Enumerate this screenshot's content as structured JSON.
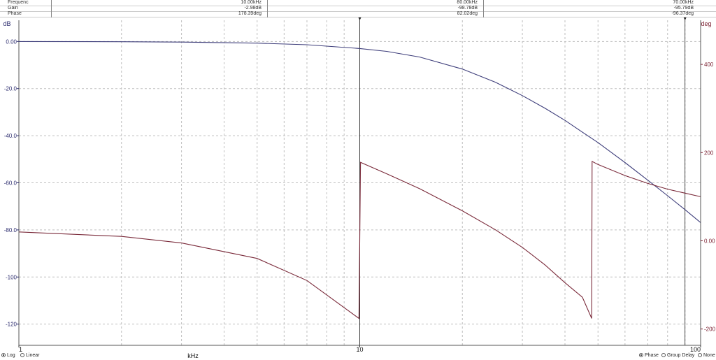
{
  "readout": {
    "labels": [
      "Frequenc",
      "Gain",
      "Phase"
    ],
    "cursor1": [
      "10.00kHz",
      "-2.98dB",
      "178.39deg"
    ],
    "cursor2": [
      "80.00kHz",
      "-98.78dB",
      "82.02deg"
    ],
    "cursor3": [
      "70.00kHz",
      "-95.79dB",
      "-96.37deg"
    ]
  },
  "footer": {
    "x_mode_options": [
      {
        "label": "Log",
        "selected": true
      },
      {
        "label": "Linear",
        "selected": false
      }
    ],
    "y2_mode_options": [
      {
        "label": "Phase",
        "selected": true
      },
      {
        "label": "Group Delay",
        "selected": false
      },
      {
        "label": "None",
        "selected": false
      }
    ]
  },
  "colors": {
    "gain": "#3d3d7a",
    "phase": "#7a2a3a",
    "grid": "#bfbfbf",
    "axis_left": "#2c2c6e",
    "axis_right": "#7a1f30",
    "cursor": "#222222"
  },
  "chart_data": {
    "type": "line",
    "x_scale": "log",
    "xlabel": "kHz",
    "x_tick_labels": [
      "1",
      "10",
      "100"
    ],
    "xlim": [
      1,
      100
    ],
    "y_left_unit": "dB",
    "y_left_ticks": [
      "0.00",
      "-20.0",
      "-40.0",
      "-60.0",
      "-80.0",
      "-100",
      "-120"
    ],
    "y_left_lim": [
      -129,
      9
    ],
    "y_right_unit": "deg",
    "y_right_ticks": [
      "400",
      "200",
      "0.00",
      "-200"
    ],
    "y_right_lim": [
      -237,
      500
    ],
    "grid": true,
    "cursors_khz": [
      10,
      90
    ],
    "series": [
      {
        "axis": "left",
        "points": [
          [
            1,
            -0.03
          ],
          [
            2,
            -0.1
          ],
          [
            3,
            -0.25
          ],
          [
            5,
            -0.7
          ],
          [
            7,
            -1.4
          ],
          [
            10,
            -2.98
          ],
          [
            12,
            -4.2
          ],
          [
            15,
            -6.6
          ],
          [
            20,
            -11.7
          ],
          [
            25,
            -17.3
          ],
          [
            30,
            -23.0
          ],
          [
            35,
            -28.4
          ],
          [
            40,
            -33.5
          ],
          [
            45,
            -38.5
          ],
          [
            50,
            -42.9
          ],
          [
            60,
            -51.4
          ],
          [
            70,
            -58.9
          ],
          [
            80,
            -65.5
          ],
          [
            90,
            -71.4
          ],
          [
            100,
            -76.9
          ]
        ]
      },
      {
        "axis": "right",
        "points": [
          [
            1,
            20
          ],
          [
            2,
            10
          ],
          [
            3,
            -5
          ],
          [
            5,
            -40
          ],
          [
            7,
            -90
          ],
          [
            9.95,
            -176
          ],
          [
            10.05,
            178
          ],
          [
            12,
            152
          ],
          [
            15,
            118
          ],
          [
            20,
            68
          ],
          [
            25,
            25
          ],
          [
            30,
            -15
          ],
          [
            35,
            -55
          ],
          [
            40,
            -95
          ],
          [
            45,
            -128
          ],
          [
            47.9,
            -176
          ],
          [
            48.05,
            180
          ],
          [
            50,
            173
          ],
          [
            60,
            148
          ],
          [
            70,
            130
          ],
          [
            80,
            117
          ],
          [
            90,
            108
          ],
          [
            100,
            100
          ]
        ]
      }
    ]
  }
}
